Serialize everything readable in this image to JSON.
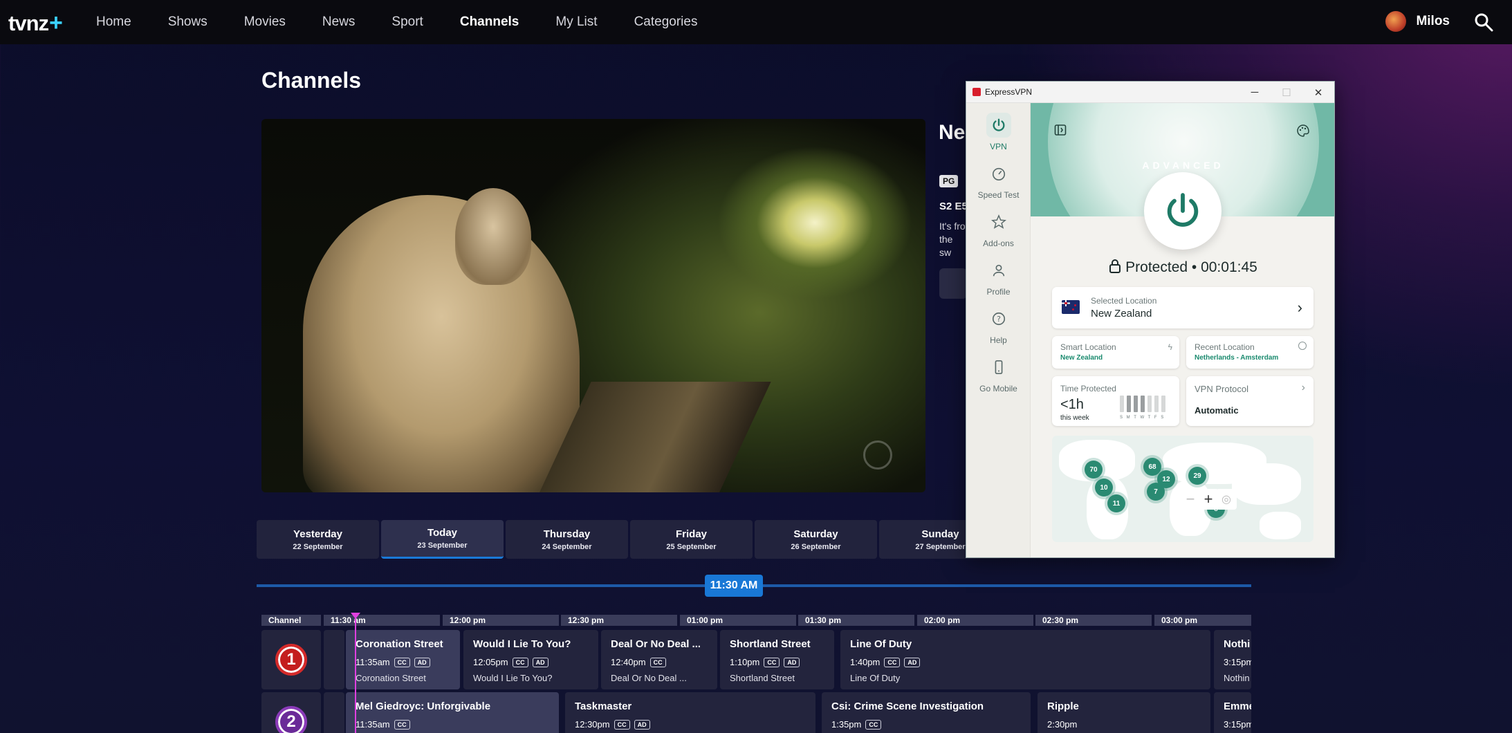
{
  "nav": {
    "logo": "tvnz",
    "logo_plus": "+",
    "items": [
      "Home",
      "Shows",
      "Movies",
      "News",
      "Sport",
      "Channels",
      "My List",
      "Categories"
    ],
    "active": "Channels",
    "user_name": "Milos"
  },
  "page": {
    "title": "Channels",
    "info_title": "Ne Re",
    "rating": "PG",
    "episode": "S2 E5",
    "description": "It's fro the sw"
  },
  "days": [
    {
      "name": "Yesterday",
      "date": "22 September"
    },
    {
      "name": "Today",
      "date": "23 September"
    },
    {
      "name": "Thursday",
      "date": "24 September"
    },
    {
      "name": "Friday",
      "date": "25 September"
    },
    {
      "name": "Saturday",
      "date": "26 September"
    },
    {
      "name": "Sunday",
      "date": "27 September"
    }
  ],
  "current_time": "11:30 AM",
  "guide": {
    "headers": [
      "Channel",
      "11:30 am",
      "12:00 pm",
      "12:30 pm",
      "01:00 pm",
      "01:30 pm",
      "02:00 pm",
      "02:30 pm",
      "03:00 pm"
    ],
    "channels": [
      "1",
      "2"
    ],
    "row1": [
      {
        "title": "Coronation Street",
        "time": "11:35am",
        "cc": "CC",
        "ad": "AD",
        "sub": "Coronation Street"
      },
      {
        "title": "Would I Lie To You?",
        "time": "12:05pm",
        "cc": "CC",
        "ad": "AD",
        "sub": "Would I Lie To You?"
      },
      {
        "title": "Deal Or No Deal ...",
        "time": "12:40pm",
        "cc": "CC",
        "sub": "Deal Or No Deal ..."
      },
      {
        "title": "Shortland Street",
        "time": "1:10pm",
        "cc": "CC",
        "ad": "AD",
        "sub": "Shortland Street"
      },
      {
        "title": "Line Of Duty",
        "time": "1:40pm",
        "cc": "CC",
        "ad": "AD",
        "sub": "Line Of Duty"
      },
      {
        "title": "Nothi",
        "time": "3:15pm",
        "sub": "Nothin"
      }
    ],
    "row2": [
      {
        "title": "Mel Giedroyc: Unforgivable",
        "time": "11:35am",
        "cc": "CC"
      },
      {
        "title": "Taskmaster",
        "time": "12:30pm",
        "cc": "CC",
        "ad": "AD"
      },
      {
        "title": "Csi: Crime Scene Investigation",
        "time": "1:35pm",
        "cc": "CC"
      },
      {
        "title": "Ripple",
        "time": "2:30pm"
      },
      {
        "title": "Emme",
        "time": "3:15pm"
      }
    ]
  },
  "vpn": {
    "window_title": "ExpressVPN",
    "sidebar": [
      "VPN",
      "Speed Test",
      "Add-ons",
      "Profile",
      "Help",
      "Go Mobile"
    ],
    "mode": "ADVANCED",
    "status": "Protected • 00:01:45",
    "selected_location_label": "Selected Location",
    "selected_location": "New Zealand",
    "smart_location_label": "Smart Location",
    "smart_location": "New Zealand",
    "recent_location_label": "Recent Location",
    "recent_location": "Netherlands - Amsterdam",
    "time_protected_label": "Time Protected",
    "time_protected": "<1h",
    "time_protected_sub": "this week",
    "week_days": "S M T W T F S",
    "protocol_label": "VPN Protocol",
    "protocol": "Automatic",
    "map_pins": [
      "70",
      "10",
      "11",
      "68",
      "12",
      "7",
      "29",
      "8"
    ],
    "accent": "#2a8a72"
  }
}
